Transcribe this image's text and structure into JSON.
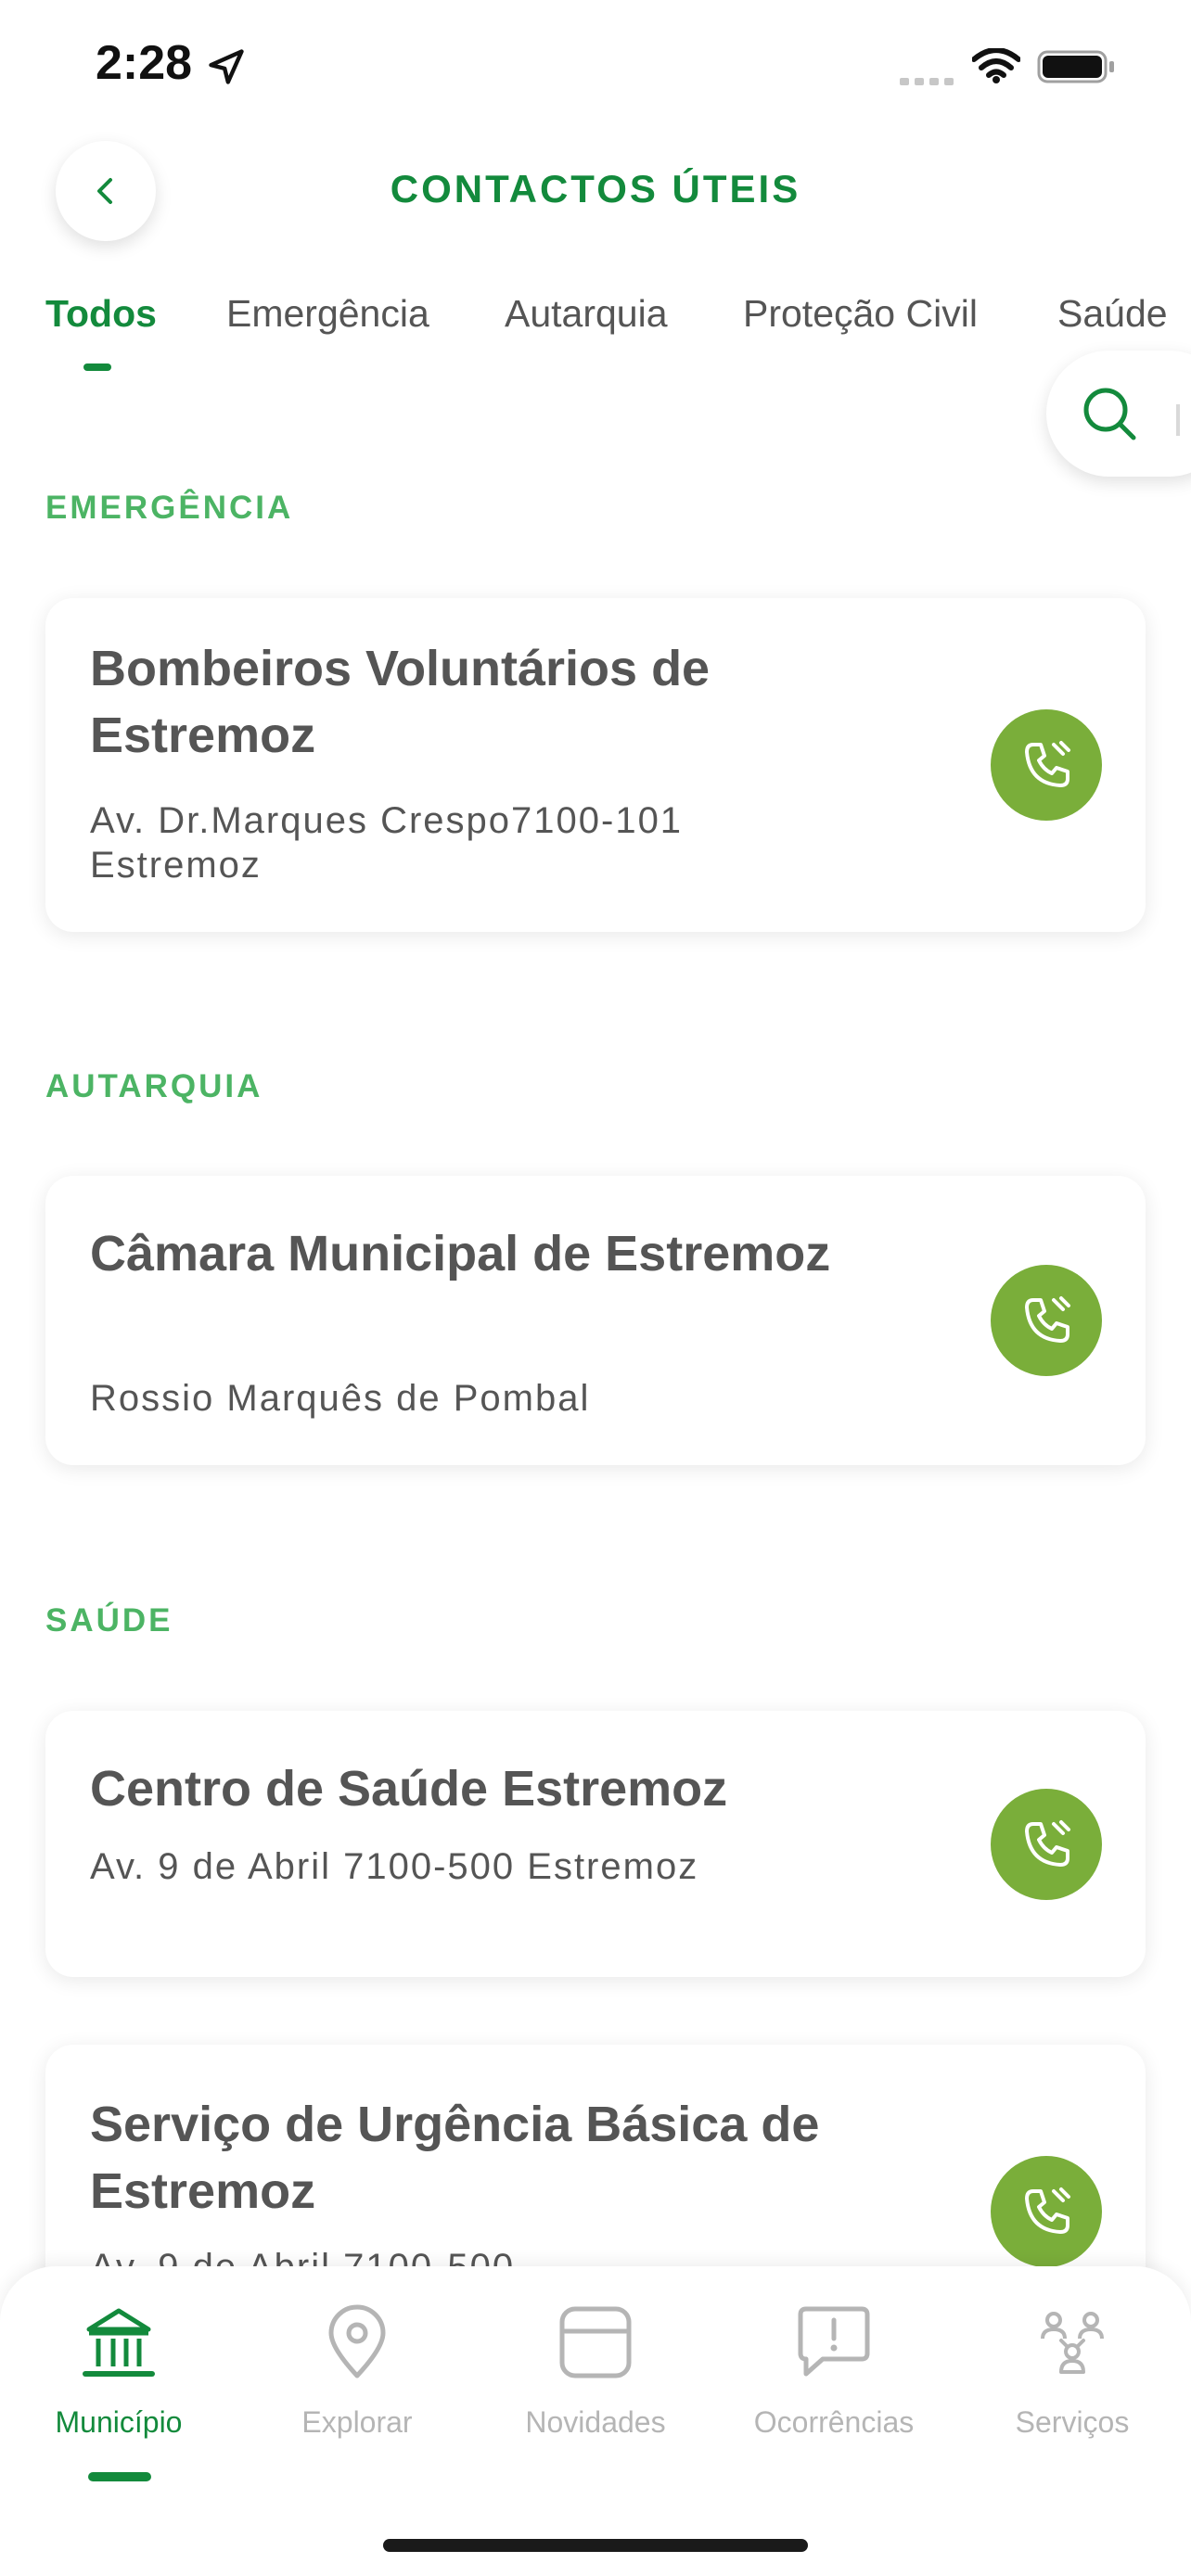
{
  "status_bar": {
    "time": "2:28"
  },
  "header": {
    "title": "CONTACTOS ÚTEIS"
  },
  "tabs": [
    {
      "label": "Todos",
      "active": true
    },
    {
      "label": "Emergência",
      "active": false
    },
    {
      "label": "Autarquia",
      "active": false
    },
    {
      "label": "Proteção Civil",
      "active": false
    },
    {
      "label": "Saúde",
      "active": false
    }
  ],
  "sections": [
    {
      "title": "EMERGÊNCIA",
      "contacts": [
        {
          "name": "Bombeiros Voluntários de Estremoz",
          "address": "Av. Dr.Marques Crespo7100-101 Estremoz"
        }
      ]
    },
    {
      "title": "AUTARQUIA",
      "contacts": [
        {
          "name": "Câmara Municipal de Estremoz",
          "address": "Rossio Marquês de Pombal"
        }
      ]
    },
    {
      "title": "SAÚDE",
      "contacts": [
        {
          "name": "Centro de Saúde Estremoz",
          "address": "Av. 9 de Abril 7100-500 Estremoz"
        },
        {
          "name": "Serviço de Urgência Básica de Estremoz",
          "address": "Av. 9 de Abril 7100-500"
        }
      ]
    }
  ],
  "bottom_nav": [
    {
      "label": "Município",
      "icon": "municipality-icon",
      "active": true
    },
    {
      "label": "Explorar",
      "icon": "map-pin-icon",
      "active": false
    },
    {
      "label": "Novidades",
      "icon": "news-icon",
      "active": false
    },
    {
      "label": "Ocorrências",
      "icon": "alert-bubble-icon",
      "active": false
    },
    {
      "label": "Serviços",
      "icon": "services-icon",
      "active": false
    }
  ],
  "colors": {
    "primary_green": "#138A3C",
    "section_green": "#4CB464",
    "call_button": "#7AAE3A",
    "inactive_gray": "#B5B5B5",
    "text_gray": "#555555"
  }
}
